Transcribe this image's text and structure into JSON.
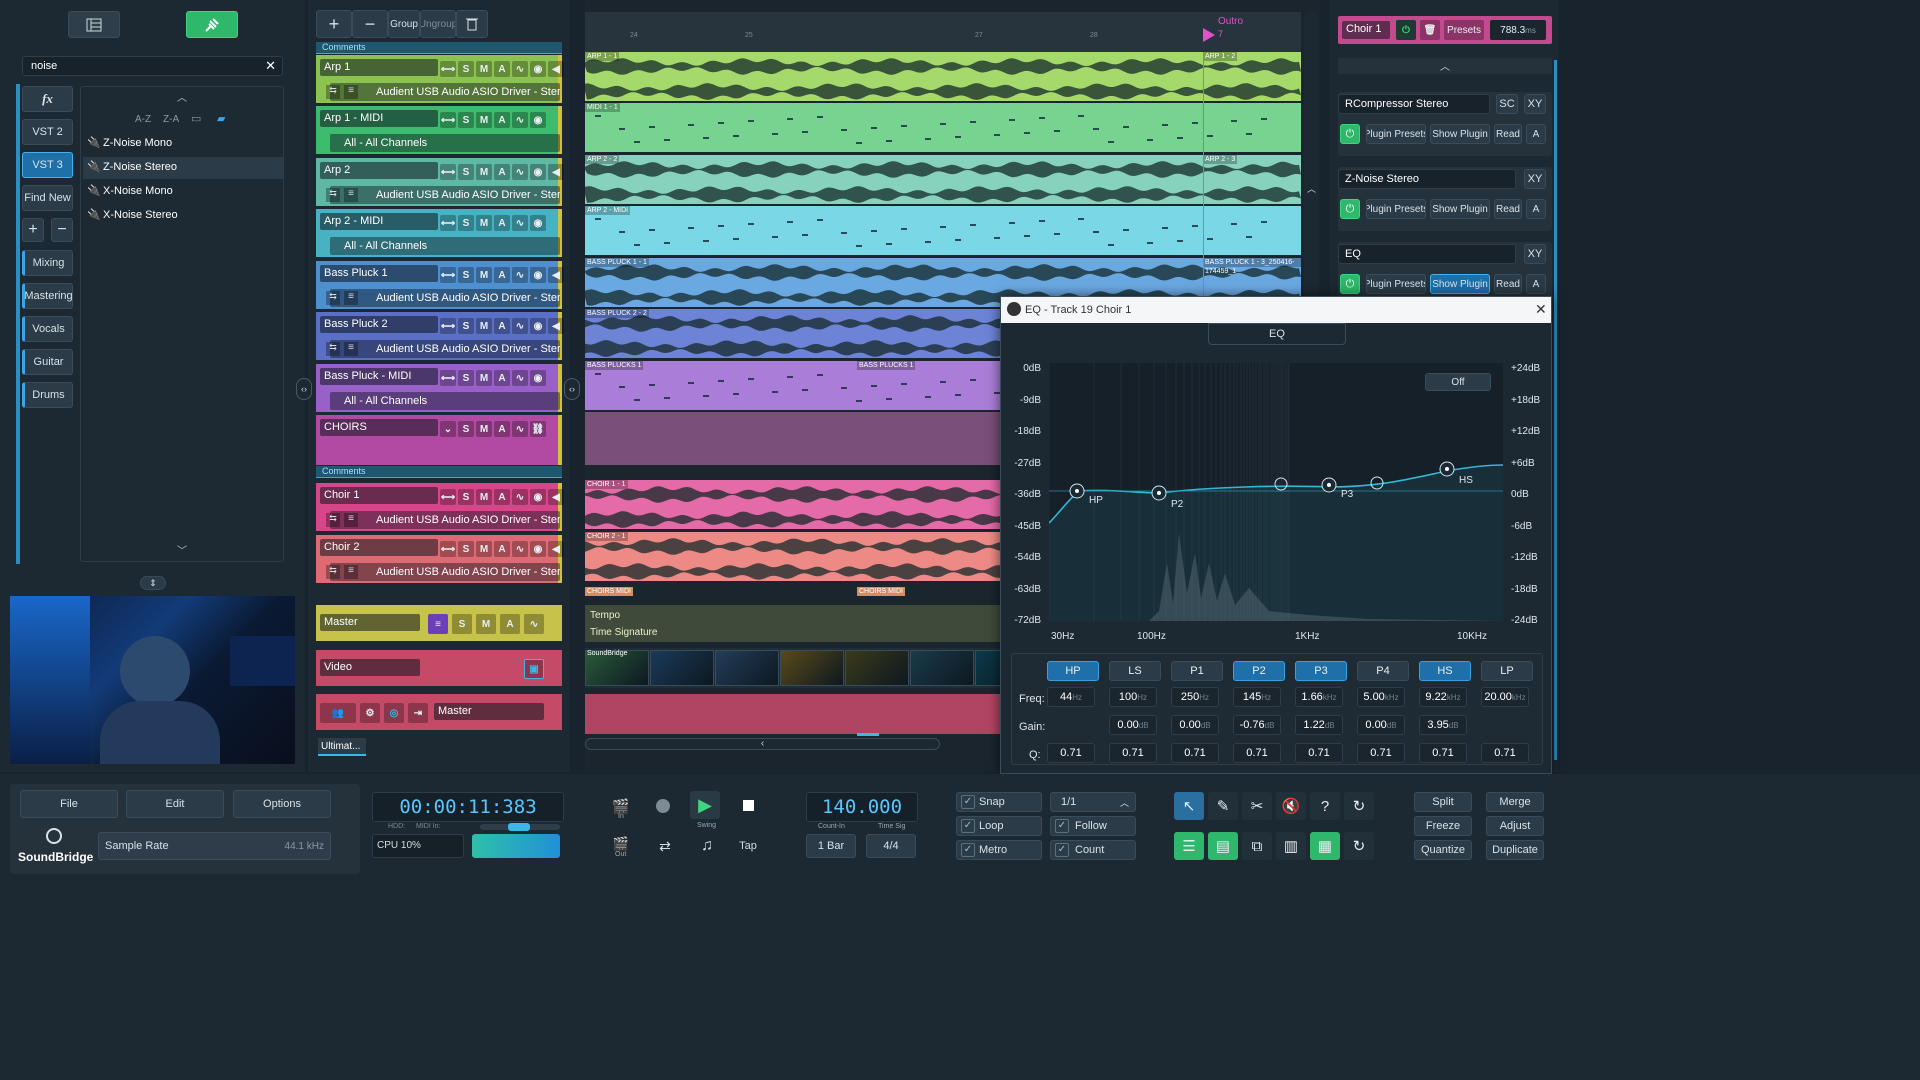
{
  "left": {
    "search": "noise",
    "fx": "fx",
    "vst2": "VST 2",
    "vst3": "VST 3",
    "find_new": "Find New",
    "sort_az": "A-Z",
    "sort_za": "Z-A",
    "categories": [
      "Mixing",
      "Mastering",
      "Vocals",
      "Guitar",
      "Drums"
    ],
    "plugins": [
      "Z-Noise Mono",
      "Z-Noise Stereo",
      "X-Noise Mono",
      "X-Noise Stereo"
    ]
  },
  "tracks_toolbar": {
    "group": "Group",
    "ungroup": "Ungroup"
  },
  "tracks": [
    {
      "name": "Arp 1",
      "sub": "Audient USB Audio ASIO Driver - Stereo 1/2"
    },
    {
      "name": "Arp 1 - MIDI",
      "sub": "All - All Channels"
    },
    {
      "name": "Arp 2",
      "sub": "Audient USB Audio ASIO Driver - Stereo 1/2"
    },
    {
      "name": "Arp 2 - MIDI",
      "sub": "All - All Channels"
    },
    {
      "name": "Bass Pluck 1",
      "sub": "Audient USB Audio ASIO Driver - Stereo 1/2"
    },
    {
      "name": "Bass Pluck 2",
      "sub": "Audient USB Audio ASIO Driver - Stereo 1/2"
    },
    {
      "name": "Bass Pluck - MIDI",
      "sub": "All - All Channels"
    },
    {
      "name": "CHOIRS",
      "sub": ""
    },
    {
      "name": "Choir 1",
      "sub": "Audient USB Audio ASIO Driver - Stereo 1/2"
    },
    {
      "name": "Choir 2",
      "sub": "Audient USB Audio ASIO Driver - Stereo 1/2"
    }
  ],
  "btn": {
    "s": "S",
    "m": "M",
    "a": "A"
  },
  "comments": "Comments",
  "master": "Master",
  "video": "Video",
  "master_out": "Master",
  "ultimat": "Ultimat...",
  "timeline": {
    "marker": "Outro",
    "marker_sub": "7",
    "bars": [
      "24",
      "25",
      "27",
      "28"
    ],
    "clips": [
      "ARP 1 - 1",
      "ARP 1 - 2",
      "MIDI 1 - 1",
      "ARP 2 - 2",
      "ARP 2 - 3",
      "ARP 2 - MIDI",
      "BASS PLUCK 1 - 1",
      "BASS PLUCK 1 - 3_250416-174459_1",
      "BASS PLUCK 2 - 2",
      "BASS PLUCKS 1",
      "BASS PLUCKS 1",
      "CHOIR 1 - 1",
      "CHOIR 2 - 1",
      "CHOIRS MIDI",
      "CHOIRS MIDI"
    ],
    "tempo": "Tempo",
    "timesig": "Time Signature",
    "video_label": "SoundBridge"
  },
  "right": {
    "track": "Choir 1",
    "presets": "Presets",
    "ms": "788.3",
    "ms_unit": "ms",
    "plugins": [
      {
        "name": "RCompressor Stereo",
        "extra": "SC",
        "xy": "XY"
      },
      {
        "name": "Z-Noise Stereo",
        "xy": "XY"
      },
      {
        "name": "EQ",
        "xy": "XY"
      }
    ],
    "plugin_presets": "Plugin Presets",
    "show_plugin": "Show Plugin",
    "read": "Read",
    "a": "A"
  },
  "eq": {
    "title": "EQ - Track 19 Choir 1",
    "tab": "EQ",
    "off": "Off",
    "left_db": [
      "0dB",
      "-9dB",
      "-18dB",
      "-27dB",
      "-36dB",
      "-45dB",
      "-54dB",
      "-63dB",
      "-72dB"
    ],
    "right_db": [
      "+24dB",
      "+18dB",
      "+12dB",
      "+6dB",
      "0dB",
      "-6dB",
      "-12dB",
      "-18dB",
      "-24dB"
    ],
    "freq_axis": [
      "30Hz",
      "100Hz",
      "1KHz",
      "10KHz"
    ],
    "points": [
      "HP",
      "P2",
      "P3",
      "HS"
    ],
    "bands": [
      {
        "label": "HP",
        "on": true
      },
      {
        "label": "LS",
        "on": false
      },
      {
        "label": "P1",
        "on": false
      },
      {
        "label": "P2",
        "on": true
      },
      {
        "label": "P3",
        "on": true
      },
      {
        "label": "P4",
        "on": false
      },
      {
        "label": "HS",
        "on": true
      },
      {
        "label": "LP",
        "on": false
      }
    ],
    "freq_label": "Freq:",
    "gain_label": "Gain:",
    "q_label": "Q:",
    "freq": [
      {
        "v": "44",
        "u": "Hz"
      },
      {
        "v": "100",
        "u": "Hz"
      },
      {
        "v": "250",
        "u": "Hz"
      },
      {
        "v": "145",
        "u": "Hz"
      },
      {
        "v": "1.66",
        "u": "kHz"
      },
      {
        "v": "5.00",
        "u": "kHz"
      },
      {
        "v": "9.22",
        "u": "kHz"
      },
      {
        "v": "20.00",
        "u": "kHz"
      }
    ],
    "gain": [
      {
        "v": "",
        "u": ""
      },
      {
        "v": "0.00",
        "u": "dB"
      },
      {
        "v": "0.00",
        "u": "dB"
      },
      {
        "v": "-0.76",
        "u": "dB"
      },
      {
        "v": "1.22",
        "u": "dB"
      },
      {
        "v": "0.00",
        "u": "dB"
      },
      {
        "v": "3.95",
        "u": "dB"
      },
      {
        "v": "",
        "u": ""
      }
    ],
    "q": [
      "0.71",
      "0.71",
      "0.71",
      "0.71",
      "0.71",
      "0.71",
      "0.71",
      "0.71"
    ]
  },
  "bottom": {
    "file": "File",
    "edit": "Edit",
    "options": "Options",
    "sample_rate": "Sample Rate",
    "sample_rate_val": "44.1 kHz",
    "time": "00:00:11:383",
    "hdd": "HDD:",
    "midi_in": "MIDI In:",
    "cpu": "CPU 10%",
    "in": "In",
    "out": "Out",
    "swing": "Swing",
    "tap": "Tap",
    "tempo": "140.000",
    "countin": "Count-In",
    "timesig": "Time Sig",
    "bar": "1 Bar",
    "sig": "4/4",
    "snap": "Snap",
    "loop": "Loop",
    "metro": "Metro",
    "grid": "1/1",
    "follow": "Follow",
    "count": "Count",
    "split": "Split",
    "merge": "Merge",
    "freeze": "Freeze",
    "adjust": "Adjust",
    "quantize": "Quantize",
    "duplicate": "Duplicate",
    "brand": "SoundBridge"
  }
}
